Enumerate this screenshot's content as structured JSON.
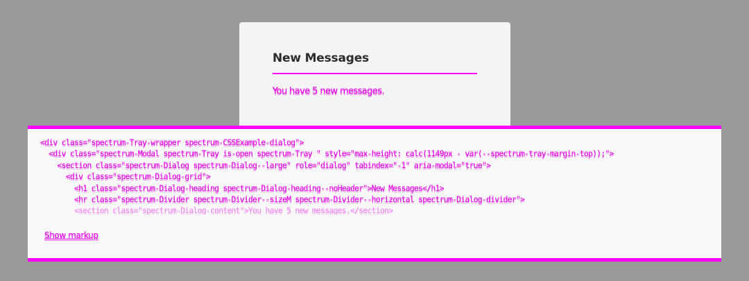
{
  "dialog": {
    "heading": "New Messages",
    "content": "You have 5 new messages."
  },
  "markup_panel": {
    "lines": [
      "<div class=\"spectrum-Tray-wrapper spectrum-CSSExample-dialog\">",
      "  <div class=\"spectrum-Modal spectrum-Tray is-open spectrum-Tray \" style=\"max-height: calc(1149px - var(--spectrum-tray-margin-top));\">",
      "    <section class=\"spectrum-Dialog spectrum-Dialog--large\" role=\"dialog\" tabindex=\"-1\" aria-modal=\"true\">",
      "      <div class=\"spectrum-Dialog-grid\">",
      "        <h1 class=\"spectrum-Dialog-heading spectrum-Dialog-heading--noHeader\">New Messages</h1>",
      "        <hr class=\"spectrum-Divider spectrum-Divider--sizeM spectrum-Divider--horizontal spectrum-Dialog-divider\">",
      "        <section class=\"spectrum-Dialog-content\">You have 5 new messages.</section>"
    ],
    "show_markup_label": "Show markup"
  }
}
